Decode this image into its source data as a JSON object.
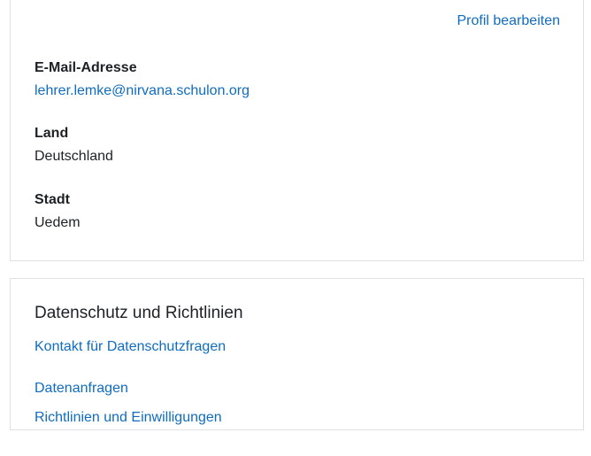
{
  "profile": {
    "edit_link": "Profil bearbeiten",
    "fields": [
      {
        "label": "E-Mail-Adresse",
        "value": "lehrer.lemke@nirvana.schulon.org"
      },
      {
        "label": "Land",
        "value": "Deutschland"
      },
      {
        "label": "Stadt",
        "value": "Uedem"
      }
    ]
  },
  "privacy": {
    "title": "Datenschutz und Richtlinien",
    "links": [
      "Kontakt für Datenschutzfragen",
      "Datenanfragen",
      "Richtlinien und Einwilligungen"
    ]
  },
  "colors": {
    "link": "#0f6cbf",
    "text": "#1d2125",
    "border": "#dee2e6"
  }
}
